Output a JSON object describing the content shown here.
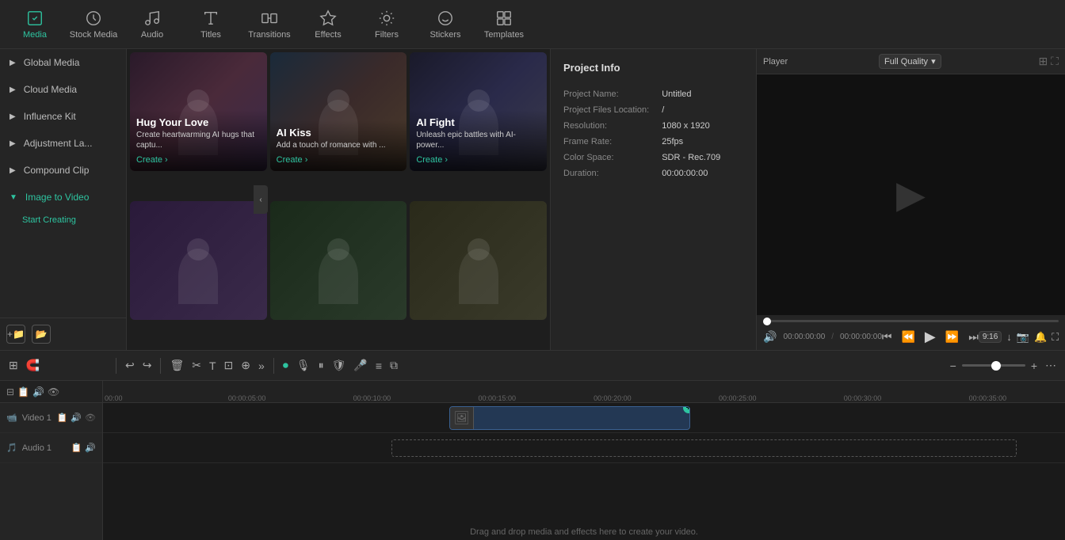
{
  "nav": {
    "items": [
      {
        "id": "media",
        "label": "Media",
        "active": true
      },
      {
        "id": "stock-media",
        "label": "Stock Media",
        "active": false
      },
      {
        "id": "audio",
        "label": "Audio",
        "active": false
      },
      {
        "id": "titles",
        "label": "Titles",
        "active": false
      },
      {
        "id": "transitions",
        "label": "Transitions",
        "active": false
      },
      {
        "id": "effects",
        "label": "Effects",
        "active": false
      },
      {
        "id": "filters",
        "label": "Filters",
        "active": false
      },
      {
        "id": "stickers",
        "label": "Stickers",
        "active": false
      },
      {
        "id": "templates",
        "label": "Templates",
        "active": false
      }
    ]
  },
  "sidebar": {
    "items": [
      {
        "id": "global-media",
        "label": "Global Media",
        "indent": 0
      },
      {
        "id": "cloud-media",
        "label": "Cloud Media",
        "indent": 0
      },
      {
        "id": "influence-kit",
        "label": "Influence Kit",
        "indent": 0
      },
      {
        "id": "adjustment-layer",
        "label": "Adjustment La...",
        "indent": 0
      },
      {
        "id": "compound-clip",
        "label": "Compound Clip",
        "indent": 0
      },
      {
        "id": "image-to-video",
        "label": "Image to Video",
        "indent": 0,
        "active": true,
        "expanded": true
      }
    ],
    "sub_items": [
      {
        "label": "Start Creating"
      }
    ]
  },
  "media_cards": [
    {
      "id": "hug-your-love",
      "title": "Hug Your Love",
      "description": "Create heartwarming AI hugs that captu...",
      "btn_label": "Create",
      "has_badge": false,
      "bg_class": "card-bg-1"
    },
    {
      "id": "ai-kiss",
      "title": "AI Kiss",
      "description": "Add a touch of romance with ...",
      "btn_label": "Create",
      "has_badge": false,
      "bg_class": "card-bg-2"
    },
    {
      "id": "ai-fight",
      "title": "AI Fight",
      "description": "Unleash epic battles with AI-power...",
      "btn_label": "Create",
      "has_badge": false,
      "bg_class": "card-bg-3"
    },
    {
      "id": "card-4",
      "title": "",
      "description": "",
      "btn_label": "",
      "has_badge": false,
      "bg_class": "card-bg-4"
    },
    {
      "id": "card-5",
      "title": "",
      "description": "",
      "btn_label": "",
      "has_badge": false,
      "bg_class": "card-bg-5"
    },
    {
      "id": "card-6",
      "title": "",
      "description": "",
      "btn_label": "",
      "has_badge": false,
      "bg_class": "card-bg-6"
    }
  ],
  "project_info": {
    "title": "Project Info",
    "fields": [
      {
        "label": "Project Name:",
        "value": "Untitled"
      },
      {
        "label": "Project Files Location:",
        "value": "/"
      },
      {
        "label": "Resolution:",
        "value": "1080 x 1920"
      },
      {
        "label": "Frame Rate:",
        "value": "25fps"
      },
      {
        "label": "Color Space:",
        "value": "SDR - Rec.709"
      },
      {
        "label": "Duration:",
        "value": "00:00:00:00"
      }
    ]
  },
  "player": {
    "title": "Player",
    "quality_label": "Full Quality",
    "current_time": "00:00:00:00",
    "total_time": "00:00:00:00",
    "aspect_ratio": "9:16"
  },
  "timeline": {
    "toolbar_buttons": [
      "undo",
      "redo",
      "delete",
      "cut",
      "text",
      "crop",
      "merge",
      "more",
      "record",
      "voiceover",
      "auto-caption",
      "stabilize",
      "speed",
      "audio-detach",
      "silence"
    ],
    "ruler_marks": [
      "00:00",
      "00:00:05:00",
      "00:00:10:00",
      "00:00:15:00",
      "00:00:20:00",
      "00:00:25:00",
      "00:00:30:00",
      "00:00:35:00"
    ],
    "tracks": [
      {
        "label": "Video 1",
        "icon": "video",
        "number": 1
      },
      {
        "label": "Audio 1",
        "icon": "audio",
        "number": 1
      }
    ],
    "drop_text": "Drag and drop media and effects here to create your video."
  }
}
